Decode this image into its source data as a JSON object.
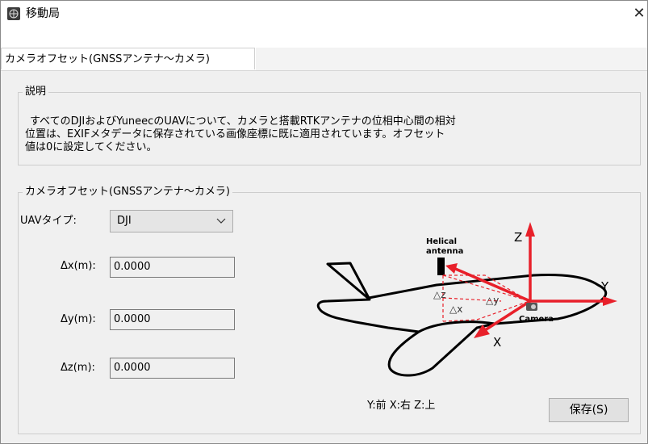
{
  "window": {
    "title": "移動局",
    "close_glyph": "✕",
    "app_icon": "globe-icon"
  },
  "tab": {
    "label": "カメラオフセット(GNSSアンテナ～カメラ)"
  },
  "info_group": {
    "title": "説明",
    "lines": [
      "すべてのDJIおよびYuneecのUAVについて、カメラと搭載RTKアンテナの位相中心間の相対",
      "位置は、EXIFメタデータに保存されている画像座標に既に適用されています。オフセット",
      "値は0に設定してください。"
    ]
  },
  "offset_group": {
    "title": "カメラオフセット(GNSSアンテナ～カメラ)",
    "uav_type_label": "UAVタイプ:",
    "uav_type_value": "DJI",
    "dx_label": "Δx(m):",
    "dx_value": "0.0000",
    "dy_label": "Δy(m):",
    "dy_value": "0.0000",
    "dz_label": "Δz(m):",
    "dz_value": "0.0000"
  },
  "diagram": {
    "helical_label_1": "Helical",
    "helical_label_2": "antenna",
    "camera_label": "Camera",
    "axis_z": "Z",
    "axis_y": "Y",
    "axis_x": "X",
    "delta_z": "△z",
    "delta_x": "△x",
    "delta_y": "△y",
    "colors": {
      "axis": "#e8202a",
      "dash": "#e8202a",
      "outline": "#000000"
    }
  },
  "legend": "Y:前  X:右  Z:上",
  "save_button": "保存(S)"
}
